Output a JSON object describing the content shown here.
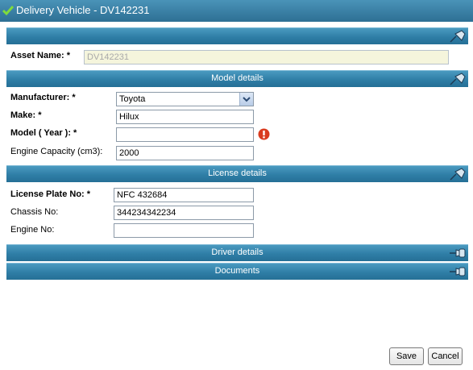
{
  "window": {
    "title": "Delivery Vehicle - DV142231"
  },
  "asset": {
    "label": "Asset Name: *",
    "value": "DV142231"
  },
  "sections": {
    "model": "Model details",
    "license": "License details",
    "driver": "Driver details",
    "documents": "Documents"
  },
  "model": {
    "manufacturer": {
      "label": "Manufacturer: *",
      "value": "Toyota"
    },
    "make": {
      "label": "Make: *",
      "value": "Hilux"
    },
    "year": {
      "label": "Model ( Year ): *",
      "value": ""
    },
    "engine_capacity": {
      "label": "Engine Capacity (cm3):",
      "value": "2000"
    }
  },
  "license": {
    "plate": {
      "label": "License Plate No: *",
      "value": "NFC 432684"
    },
    "chassis": {
      "label": "Chassis No:",
      "value": "344234342234"
    },
    "engine_no": {
      "label": "Engine No:",
      "value": ""
    }
  },
  "buttons": {
    "save": "Save",
    "cancel": "Cancel"
  },
  "icons": {
    "title": "check-icon",
    "pin": "pin-icon",
    "error": "error-icon",
    "dropdown": "chevron-down-icon"
  },
  "colors": {
    "header": "#2f7ea6",
    "readonly_field": "#f5f5dc",
    "error": "#d93b1f"
  }
}
